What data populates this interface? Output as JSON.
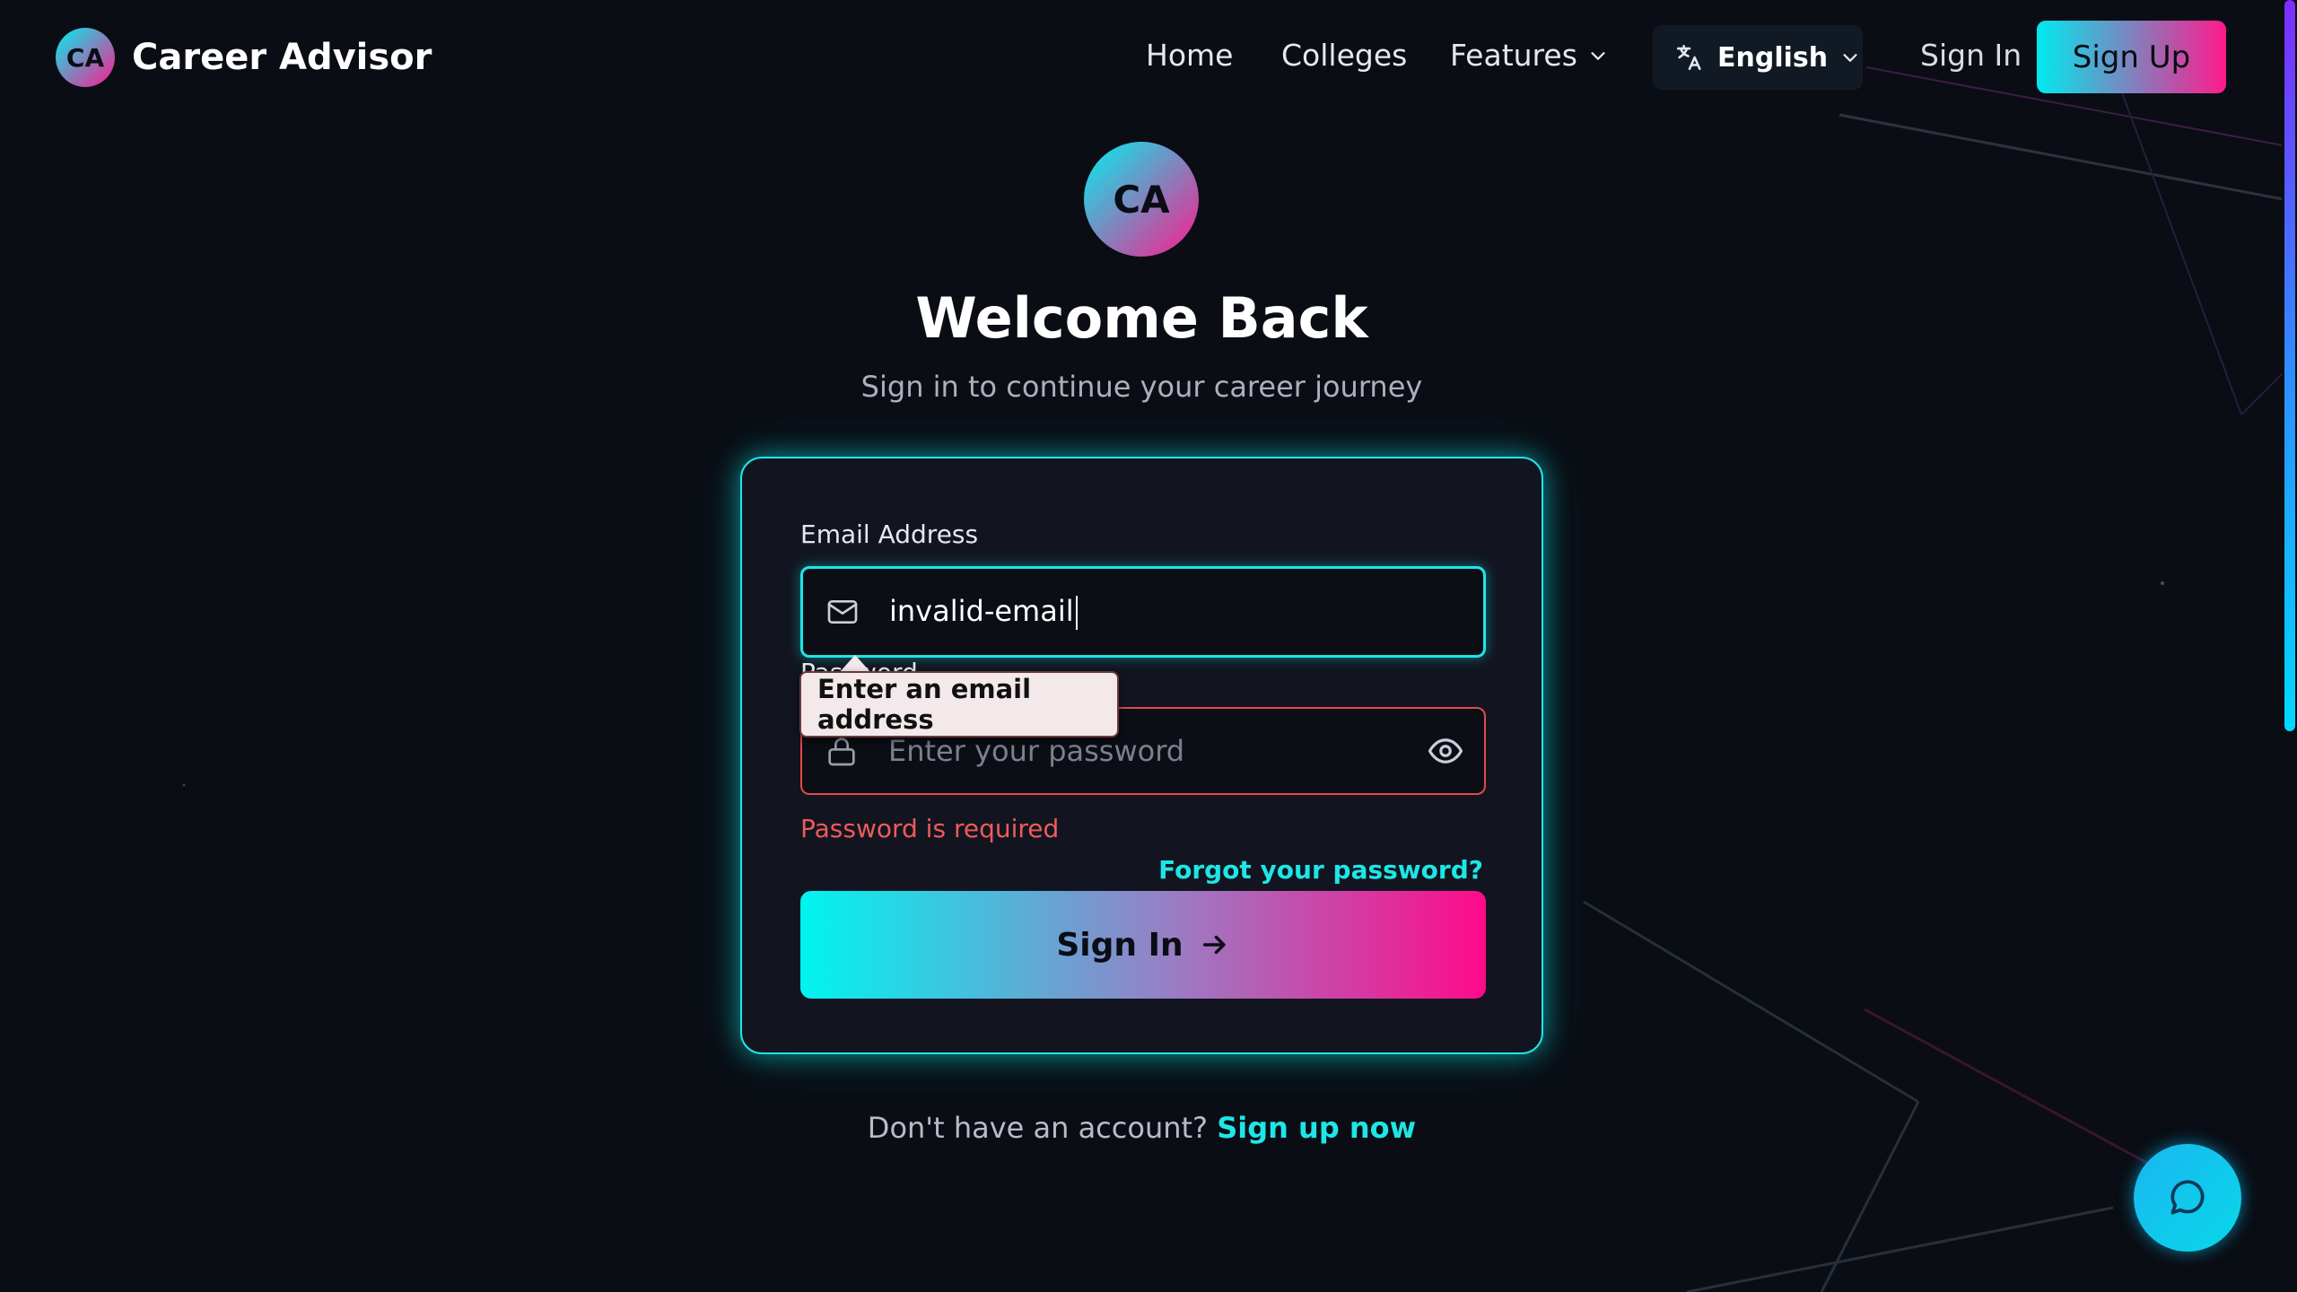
{
  "brand": {
    "logo_text": "CA",
    "name": "Career Advisor"
  },
  "nav": {
    "home": "Home",
    "colleges": "Colleges",
    "features": "Features",
    "language": "English",
    "sign_in": "Sign In",
    "sign_up": "Sign Up"
  },
  "header": {
    "logo_text": "CA",
    "title": "Welcome Back",
    "subtitle": "Sign in to continue your career journey"
  },
  "form": {
    "email_label": "Email Address",
    "email_value": "invalid-email",
    "password_label": "Password",
    "password_placeholder": "Enter your password",
    "password_error": "Password is required",
    "forgot_link": "Forgot your password?",
    "submit_label": "Sign In",
    "validation_tooltip": "Enter an email address"
  },
  "footer": {
    "prompt": "Don't have an account?",
    "signup_link": "Sign up now"
  },
  "icons": {
    "brand": "brand-logo",
    "language": "translate-icon",
    "features_dropdown": "chevron-down-icon",
    "email": "mail-icon",
    "password": "lock-icon",
    "visibility": "eye-icon",
    "submit": "arrow-right-icon",
    "chat": "chat-bubble-icon"
  },
  "colors": {
    "background": "#0a0d14",
    "accent_cyan": "#1ee6e6",
    "accent_pink": "#ff1a8c",
    "error": "#ec5b5b"
  }
}
